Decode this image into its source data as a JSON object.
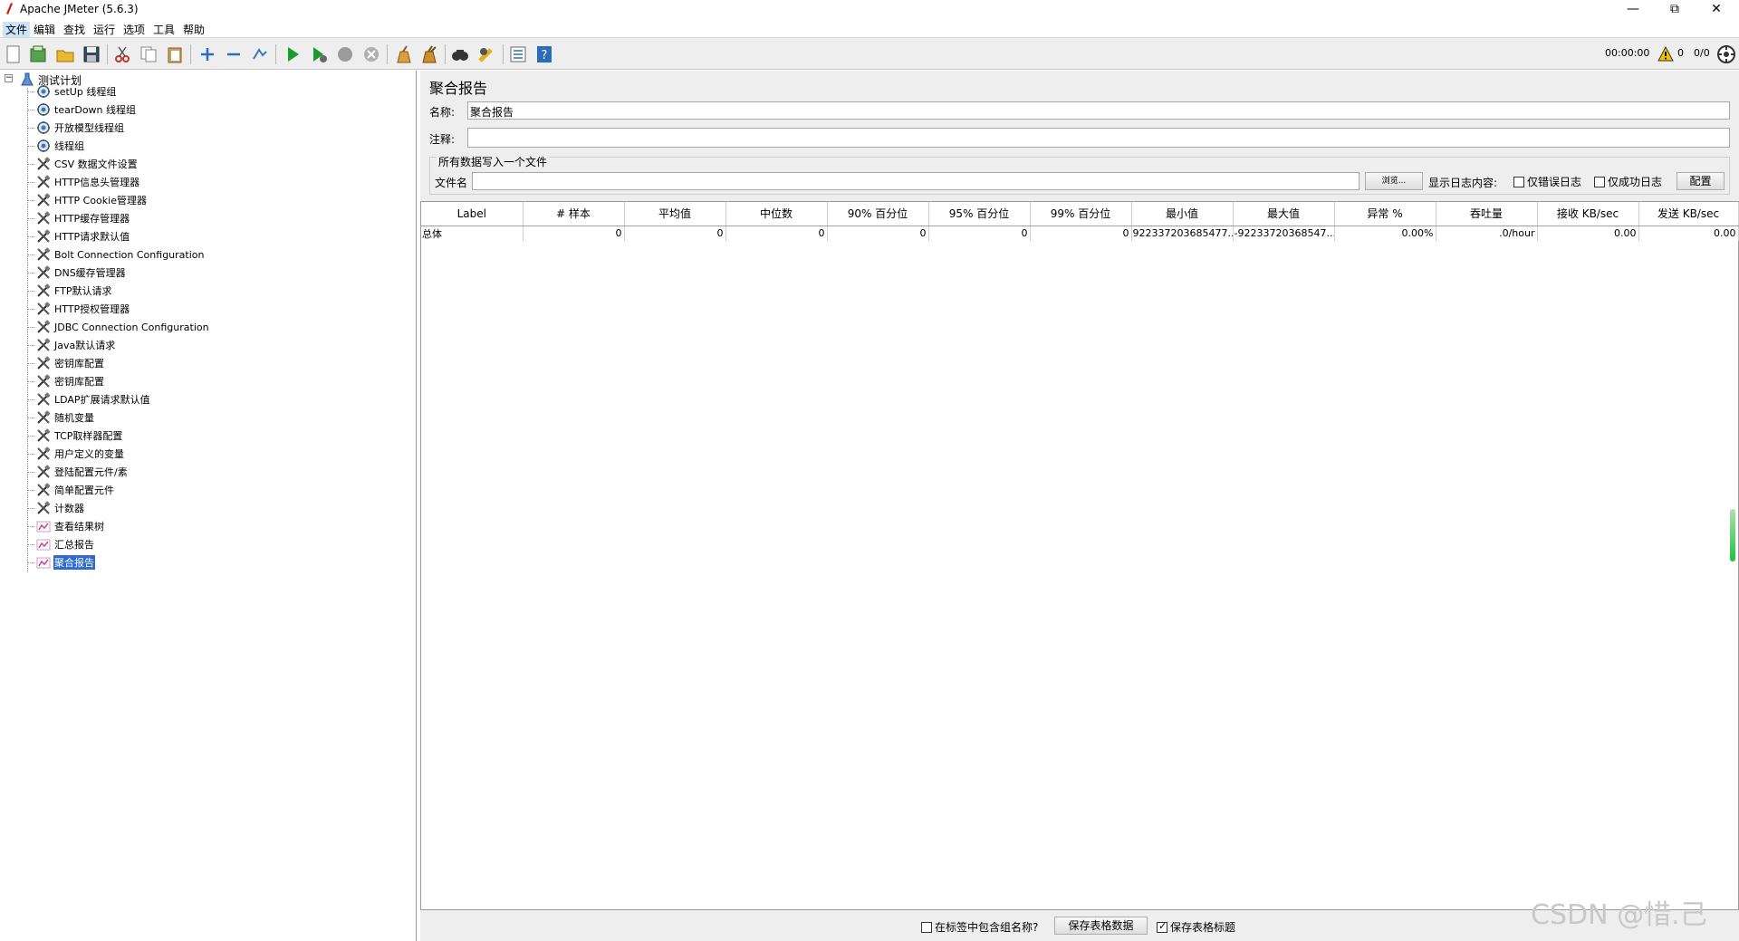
{
  "window": {
    "title": "Apache JMeter (5.6.3)"
  },
  "menu": [
    "文件",
    "编辑",
    "查找",
    "运行",
    "选项",
    "工具",
    "帮助"
  ],
  "toolbar": {
    "timer": "00:00:00",
    "warnings": "0",
    "threads": "0/0"
  },
  "tree": {
    "root": "测试计划",
    "items": [
      {
        "label": "setUp 线程组",
        "type": "thread"
      },
      {
        "label": "tearDown 线程组",
        "type": "thread"
      },
      {
        "label": "开放模型线程组",
        "type": "thread"
      },
      {
        "label": "线程组",
        "type": "thread"
      },
      {
        "label": "CSV 数据文件设置",
        "type": "config"
      },
      {
        "label": "HTTP信息头管理器",
        "type": "config"
      },
      {
        "label": "HTTP Cookie管理器",
        "type": "config"
      },
      {
        "label": "HTTP缓存管理器",
        "type": "config"
      },
      {
        "label": "HTTP请求默认值",
        "type": "config"
      },
      {
        "label": "Bolt Connection Configuration",
        "type": "config"
      },
      {
        "label": "DNS缓存管理器",
        "type": "config"
      },
      {
        "label": "FTP默认请求",
        "type": "config"
      },
      {
        "label": "HTTP授权管理器",
        "type": "config"
      },
      {
        "label": "JDBC Connection Configuration",
        "type": "config"
      },
      {
        "label": "Java默认请求",
        "type": "config"
      },
      {
        "label": "密钥库配置",
        "type": "config"
      },
      {
        "label": "密钥库配置",
        "type": "config"
      },
      {
        "label": "LDAP扩展请求默认值",
        "type": "config"
      },
      {
        "label": "随机变量",
        "type": "config"
      },
      {
        "label": "TCP取样器配置",
        "type": "config"
      },
      {
        "label": "用户定义的变量",
        "type": "config"
      },
      {
        "label": "登陆配置元件/素",
        "type": "config"
      },
      {
        "label": "简单配置元件",
        "type": "config"
      },
      {
        "label": "计数器",
        "type": "config"
      },
      {
        "label": "查看结果树",
        "type": "listener"
      },
      {
        "label": "汇总报告",
        "type": "listener"
      },
      {
        "label": "聚合报告",
        "type": "listener",
        "selected": true
      }
    ]
  },
  "panel": {
    "title": "聚合报告",
    "name_label": "名称:",
    "name_value": "聚合报告",
    "comment_label": "注释:",
    "comment_value": "",
    "file_group_title": "所有数据写入一个文件",
    "filename_label": "文件名",
    "filename_value": "",
    "browse_button": "浏览...",
    "log_label": "显示日志内容:",
    "errors_only": "仅错误日志",
    "success_only": "仅成功日志",
    "configure_button": "配置"
  },
  "table": {
    "headers": [
      "Label",
      "# 样本",
      "平均值",
      "中位数",
      "90% 百分位",
      "95% 百分位",
      "99% 百分位",
      "最小值",
      "最大值",
      "异常 %",
      "吞吐量",
      "接收 KB/sec",
      "发送 KB/sec"
    ],
    "rows": [
      [
        "总体",
        "0",
        "0",
        "0",
        "0",
        "0",
        "0",
        "922337203685477...",
        "-92233720368547...",
        "0.00%",
        ".0/hour",
        "0.00",
        "0.00"
      ]
    ]
  },
  "bottom": {
    "include_group_name": "在标签中包含组名称?",
    "save_table_data": "保存表格数据",
    "save_table_header": "保存表格标题",
    "save_table_header_checked": true,
    "include_group_name_checked": false
  },
  "watermark": "CSDN @惜.己"
}
